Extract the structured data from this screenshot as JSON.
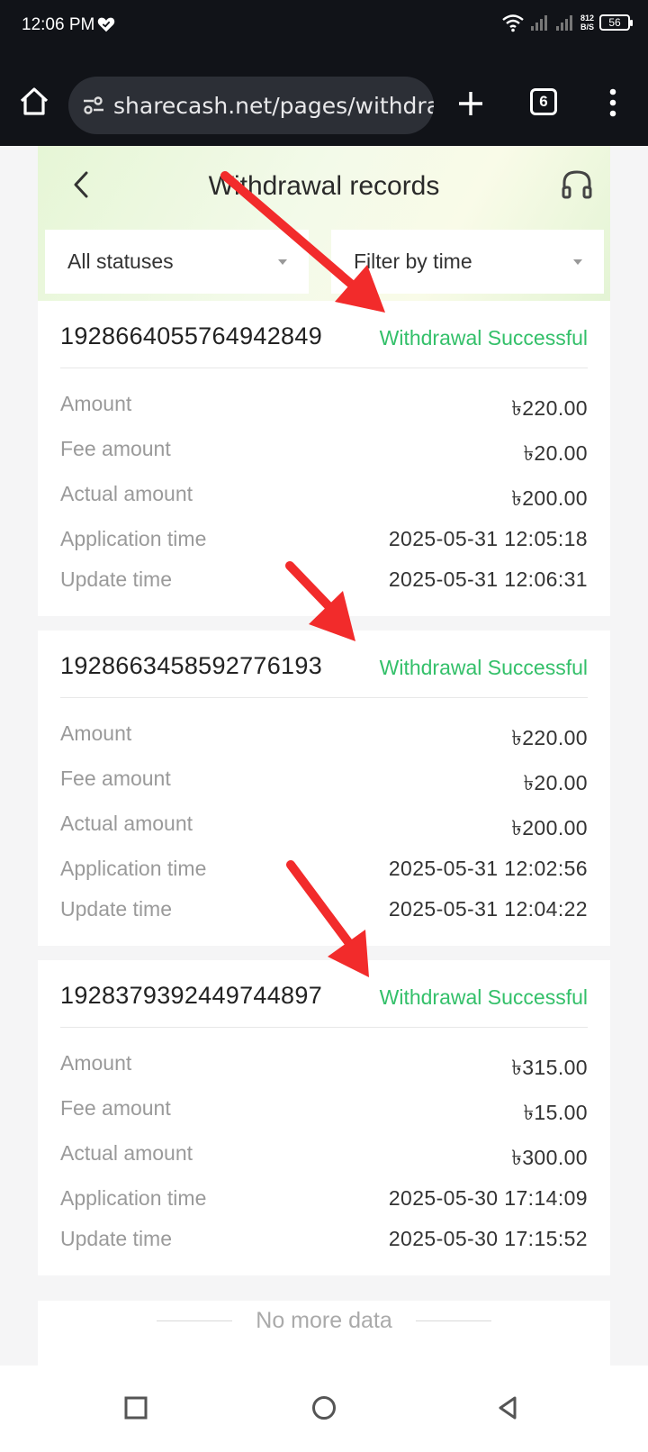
{
  "status_bar": {
    "time": "12:06 PM",
    "speed_value": "812",
    "speed_unit": "B/S",
    "battery": "56"
  },
  "browser": {
    "url": "sharecash.net/pages/withdrawal,",
    "tab_count": "6"
  },
  "header": {
    "title": "Withdrawal records"
  },
  "filters": {
    "status": "All statuses",
    "time": "Filter by time"
  },
  "records": [
    {
      "id": "1928664055764942849",
      "status": "Withdrawal Successful",
      "rows": [
        {
          "label": "Amount",
          "value": "৳220.00"
        },
        {
          "label": "Fee amount",
          "value": "৳20.00"
        },
        {
          "label": "Actual amount",
          "value": "৳200.00"
        },
        {
          "label": "Application time",
          "value": "2025-05-31 12:05:18"
        },
        {
          "label": "Update time",
          "value": "2025-05-31 12:06:31"
        }
      ]
    },
    {
      "id": "1928663458592776193",
      "status": "Withdrawal Successful",
      "rows": [
        {
          "label": "Amount",
          "value": "৳220.00"
        },
        {
          "label": "Fee amount",
          "value": "৳20.00"
        },
        {
          "label": "Actual amount",
          "value": "৳200.00"
        },
        {
          "label": "Application time",
          "value": "2025-05-31 12:02:56"
        },
        {
          "label": "Update time",
          "value": "2025-05-31 12:04:22"
        }
      ]
    },
    {
      "id": "1928379392449744897",
      "status": "Withdrawal Successful",
      "rows": [
        {
          "label": "Amount",
          "value": "৳315.00"
        },
        {
          "label": "Fee amount",
          "value": "৳15.00"
        },
        {
          "label": "Actual amount",
          "value": "৳300.00"
        },
        {
          "label": "Application time",
          "value": "2025-05-30 17:14:09"
        },
        {
          "label": "Update time",
          "value": "2025-05-30 17:15:52"
        }
      ]
    }
  ],
  "footer": {
    "no_more": "No more data"
  },
  "colors": {
    "success": "#34c06a",
    "annotation_arrow": "#f22b2b"
  }
}
